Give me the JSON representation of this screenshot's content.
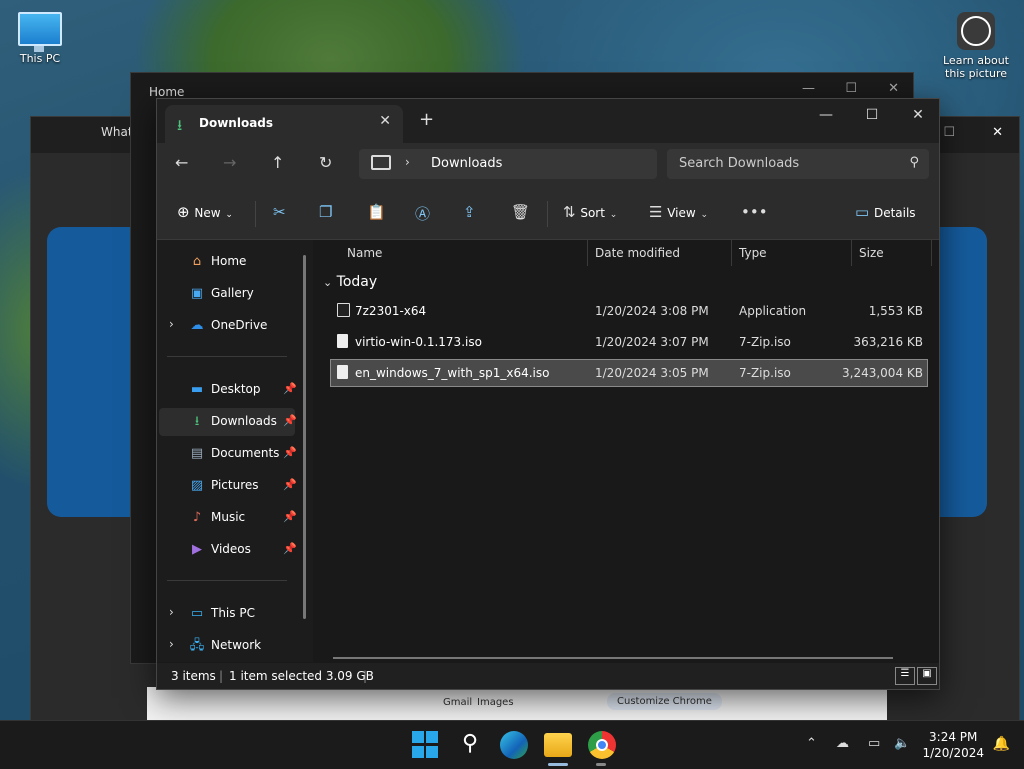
{
  "desktop": {
    "icons": [
      {
        "label": "This PC"
      },
      {
        "label": "Learn about this picture"
      }
    ]
  },
  "background_windows": {
    "chrome_tab": "What",
    "home_tab": "Home",
    "chrome_footer": [
      "Gmail",
      "Images",
      "Customize Chrome"
    ]
  },
  "explorer": {
    "tab_title": "Downloads",
    "address": {
      "current": "Downloads"
    },
    "search_placeholder": "Search Downloads",
    "toolbar": {
      "new_label": "New",
      "sort_label": "Sort",
      "view_label": "View",
      "details_label": "Details"
    },
    "sidebar": {
      "top": [
        {
          "label": "Home",
          "icon": "home-icon"
        },
        {
          "label": "Gallery",
          "icon": "gallery-icon"
        },
        {
          "label": "OneDrive",
          "icon": "cloud-icon"
        }
      ],
      "quick_access": [
        {
          "label": "Desktop",
          "icon": "desktop-icon"
        },
        {
          "label": "Downloads",
          "icon": "download-icon"
        },
        {
          "label": "Documents",
          "icon": "documents-icon"
        },
        {
          "label": "Pictures",
          "icon": "pictures-icon"
        },
        {
          "label": "Music",
          "icon": "music-icon"
        },
        {
          "label": "Videos",
          "icon": "videos-icon"
        }
      ],
      "bottom": [
        {
          "label": "This PC",
          "icon": "pc-icon"
        },
        {
          "label": "Network",
          "icon": "network-icon"
        }
      ]
    },
    "columns": [
      "Name",
      "Date modified",
      "Type",
      "Size"
    ],
    "group": "Today",
    "files": [
      {
        "name": "7z2301-x64",
        "date": "1/20/2024 3:08 PM",
        "type": "Application",
        "size": "1,553 KB"
      },
      {
        "name": "virtio-win-0.1.173.iso",
        "date": "1/20/2024 3:07 PM",
        "type": "7-Zip.iso",
        "size": "363,216 KB"
      },
      {
        "name": "en_windows_7_with_sp1_x64.iso",
        "date": "1/20/2024 3:05 PM",
        "type": "7-Zip.iso",
        "size": "3,243,004 KB"
      }
    ],
    "status": {
      "items": "3 items",
      "selected": "1 item selected  3.09 GB"
    }
  },
  "taskbar": {
    "clock_time": "3:24 PM",
    "clock_date": "1/20/2024"
  },
  "colors": {
    "accent": "#4cc2ff",
    "download_green": "#4cc27c",
    "toolbar_blue": "#7fc6f5"
  }
}
